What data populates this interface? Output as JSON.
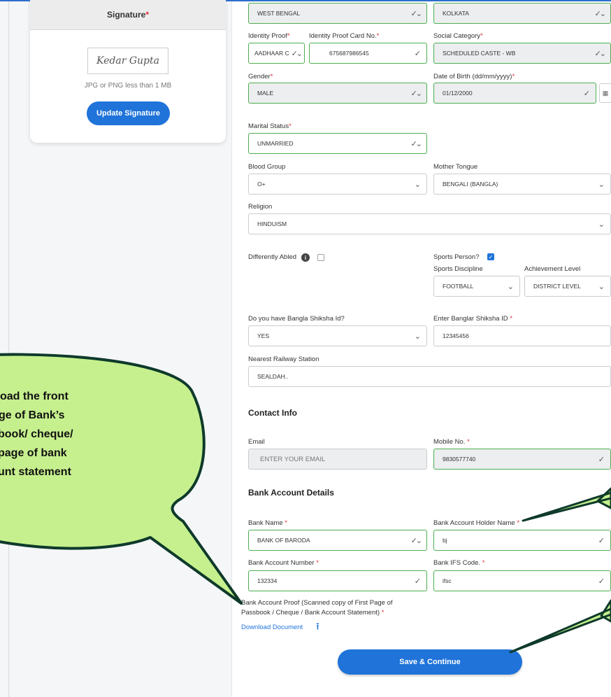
{
  "signature_card": {
    "title": "Signature",
    "required_mark": "*",
    "signature_text": "Kedar Gupta",
    "hint": "JPG or PNG less than 1 MB",
    "update_button": "Update Signature"
  },
  "form": {
    "state": {
      "value": "WEST BENGAL"
    },
    "district": {
      "value": "KOLKATA"
    },
    "identity_proof": {
      "label": "Identity Proof",
      "value": "AADHAAR C"
    },
    "identity_proof_no": {
      "label": "Identity Proof Card No.",
      "value": "675687986545"
    },
    "social_category": {
      "label": "Social Category",
      "value": "SCHEDULED CASTE - WB"
    },
    "gender": {
      "label": "Gender",
      "value": "MALE"
    },
    "dob": {
      "label": "Date of Birth (dd/mm/yyyy)",
      "value": "01/12/2000"
    },
    "marital_status": {
      "label": "Marital Status",
      "value": "UNMARRIED"
    },
    "blood_group": {
      "label": "Blood Group",
      "value": "O+"
    },
    "mother_tongue": {
      "label": "Mother Tongue",
      "value": "BENGALI (BANGLA)"
    },
    "religion": {
      "label": "Religion",
      "value": "HINDUISM"
    },
    "differently_abled": {
      "label": "Differently Abled",
      "checked": false
    },
    "sports_person": {
      "label": "Sports Person?",
      "checked": true
    },
    "sports_discipline": {
      "label": "Sports Discipline",
      "value": "FOOTBALL"
    },
    "achievement_level": {
      "label": "Achievement Level",
      "value": "DISTRICT LEVEL"
    },
    "bangla_shiksha": {
      "label": "Do you have Bangla Shiksha Id?",
      "value": "YES"
    },
    "banglar_shiksha_id": {
      "label": "Enter Banglar Shiksha ID",
      "value": "12345456"
    },
    "railway_station": {
      "label": "Nearest Railway Station",
      "value": "SEALDAH.."
    },
    "contact_title": "Contact Info",
    "email": {
      "label": "Email",
      "placeholder": "ENTER YOUR EMAIL"
    },
    "mobile": {
      "label": "Mobile No.",
      "value": "9830577740"
    },
    "bank_title": "Bank Account Details",
    "bank_name": {
      "label": "Bank Name",
      "value": "BANK OF BARODA"
    },
    "holder_name": {
      "label": "Bank Account Holder Name",
      "value": "bj"
    },
    "account_number": {
      "label": "Bank Account Number",
      "value": "132334"
    },
    "ifsc": {
      "label": "Bank IFS Code.",
      "value": "ifsc"
    },
    "proof_label_1": "Bank Account Proof (Scanned copy of First Page of",
    "proof_label_2": "Passbook / Cheque / Bank Account Statement)",
    "download_link": "Download Document",
    "save_button": "Save & Continue",
    "required_mark": "*"
  },
  "callout": {
    "line1": "oad the front",
    "line2": "ge of Bank’s",
    "line3": "book/ cheque/",
    "line4": "page of bank",
    "line5": "unt statement"
  },
  "colors": {
    "primary": "#1f73d9",
    "valid": "#4caf50",
    "required": "#e0303a",
    "callout_fill": "#c6f08e",
    "callout_stroke": "#0e3a2a"
  }
}
